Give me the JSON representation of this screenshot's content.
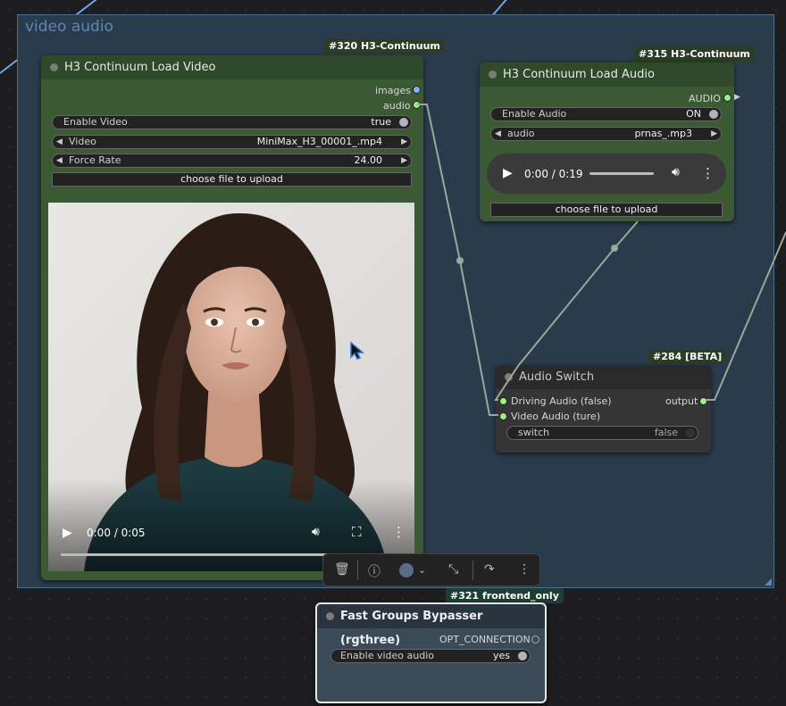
{
  "group": {
    "title": "video audio"
  },
  "load_video": {
    "badge": "#320 H3-Continuum",
    "title": "H3 Continuum Load Video",
    "outputs": [
      "images",
      "audio"
    ],
    "enable_video": {
      "label": "Enable Video",
      "value": "true"
    },
    "video": {
      "label": "Video",
      "value": "MiniMax_H3_00001_.mp4"
    },
    "force_rate": {
      "label": "Force Rate",
      "value": "24.00"
    },
    "upload": "choose file to upload",
    "player": {
      "time": "0:00 / 0:05",
      "progress": 0.0
    }
  },
  "load_audio": {
    "badge": "#315 H3-Continuum",
    "title": "H3 Continuum Load Audio",
    "output": "AUDIO",
    "enable_audio": {
      "label": "Enable Audio",
      "value": "ON"
    },
    "audio": {
      "label": "audio",
      "value": "prnas_.mp3"
    },
    "player": {
      "time": "0:00 / 0:19"
    },
    "upload": "choose file to upload"
  },
  "audio_switch": {
    "badge": "#284 [BETA]",
    "title": "Audio Switch",
    "inputs": [
      "Driving Audio (false)",
      "Video Audio (ture)"
    ],
    "output": "output",
    "switch": {
      "label": "switch",
      "value": "false"
    }
  },
  "bypasser": {
    "badge": "#321 frontend_only",
    "title": "Fast Groups Bypasser (rgthree)",
    "output": "OPT_CONNECTION",
    "toggle": {
      "label": "Enable video audio",
      "value": "yes"
    }
  },
  "colors": {
    "video_node_body": "#3b5a33",
    "video_node_header": "#2f4a2a",
    "link": "#9aa89a",
    "image_link": "#6aa5e6",
    "slot_green": "#9af08a",
    "slot_blue": "#7fb4ff"
  }
}
